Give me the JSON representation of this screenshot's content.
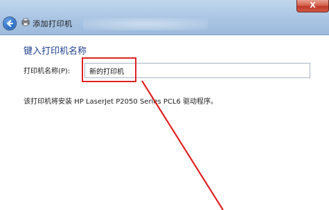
{
  "window": {
    "title": "添加打印机",
    "close_label": "X",
    "accent_color": "#1e3f8f",
    "annotation_color": "#e02020"
  },
  "icons": {
    "back": "back-arrow-icon",
    "printer": "printer-icon"
  },
  "page": {
    "heading": "键入打印机名称",
    "name_label": "打印机名称(P):",
    "name_value": "新的打印机",
    "driver_info": "该打印机将安装 HP LaserJet P2050 Series PCL6 驱动程序。"
  }
}
